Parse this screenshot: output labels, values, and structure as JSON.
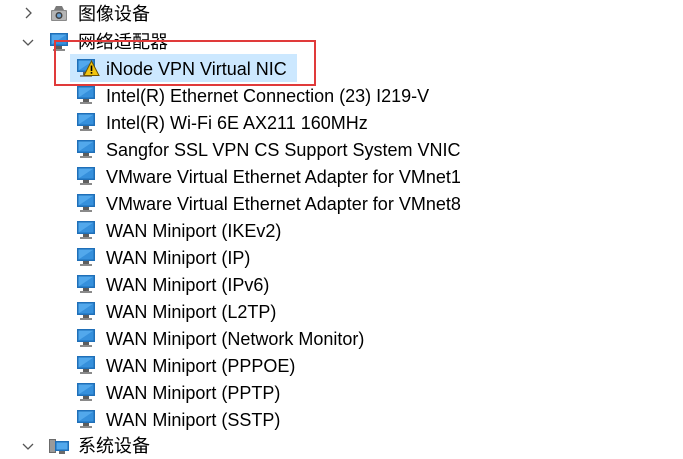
{
  "categories": [
    {
      "label": "图像设备",
      "expanded": false,
      "icon": "camera-icon"
    },
    {
      "label": "网络适配器",
      "expanded": true,
      "icon": "network-adapter-icon"
    },
    {
      "label": "系统设备",
      "expanded": true,
      "icon": "system-device-icon"
    }
  ],
  "adapters": [
    {
      "label": "iNode VPN Virtual NIC",
      "warning": true,
      "selected": true
    },
    {
      "label": "Intel(R) Ethernet Connection (23) I219-V"
    },
    {
      "label": "Intel(R) Wi-Fi 6E AX211 160MHz"
    },
    {
      "label": "Sangfor SSL VPN CS Support System VNIC"
    },
    {
      "label": "VMware Virtual Ethernet Adapter for VMnet1"
    },
    {
      "label": "VMware Virtual Ethernet Adapter for VMnet8"
    },
    {
      "label": "WAN Miniport (IKEv2)"
    },
    {
      "label": "WAN Miniport (IP)"
    },
    {
      "label": "WAN Miniport (IPv6)"
    },
    {
      "label": "WAN Miniport (L2TP)"
    },
    {
      "label": "WAN Miniport (Network Monitor)"
    },
    {
      "label": "WAN Miniport (PPPOE)"
    },
    {
      "label": "WAN Miniport (PPTP)"
    },
    {
      "label": "WAN Miniport (SSTP)"
    }
  ],
  "colors": {
    "selection": "#cce8ff",
    "annotation_box": "#e03a3a",
    "monitor_blue": "#2a8ad8",
    "warning_yellow": "#f2c40f"
  }
}
